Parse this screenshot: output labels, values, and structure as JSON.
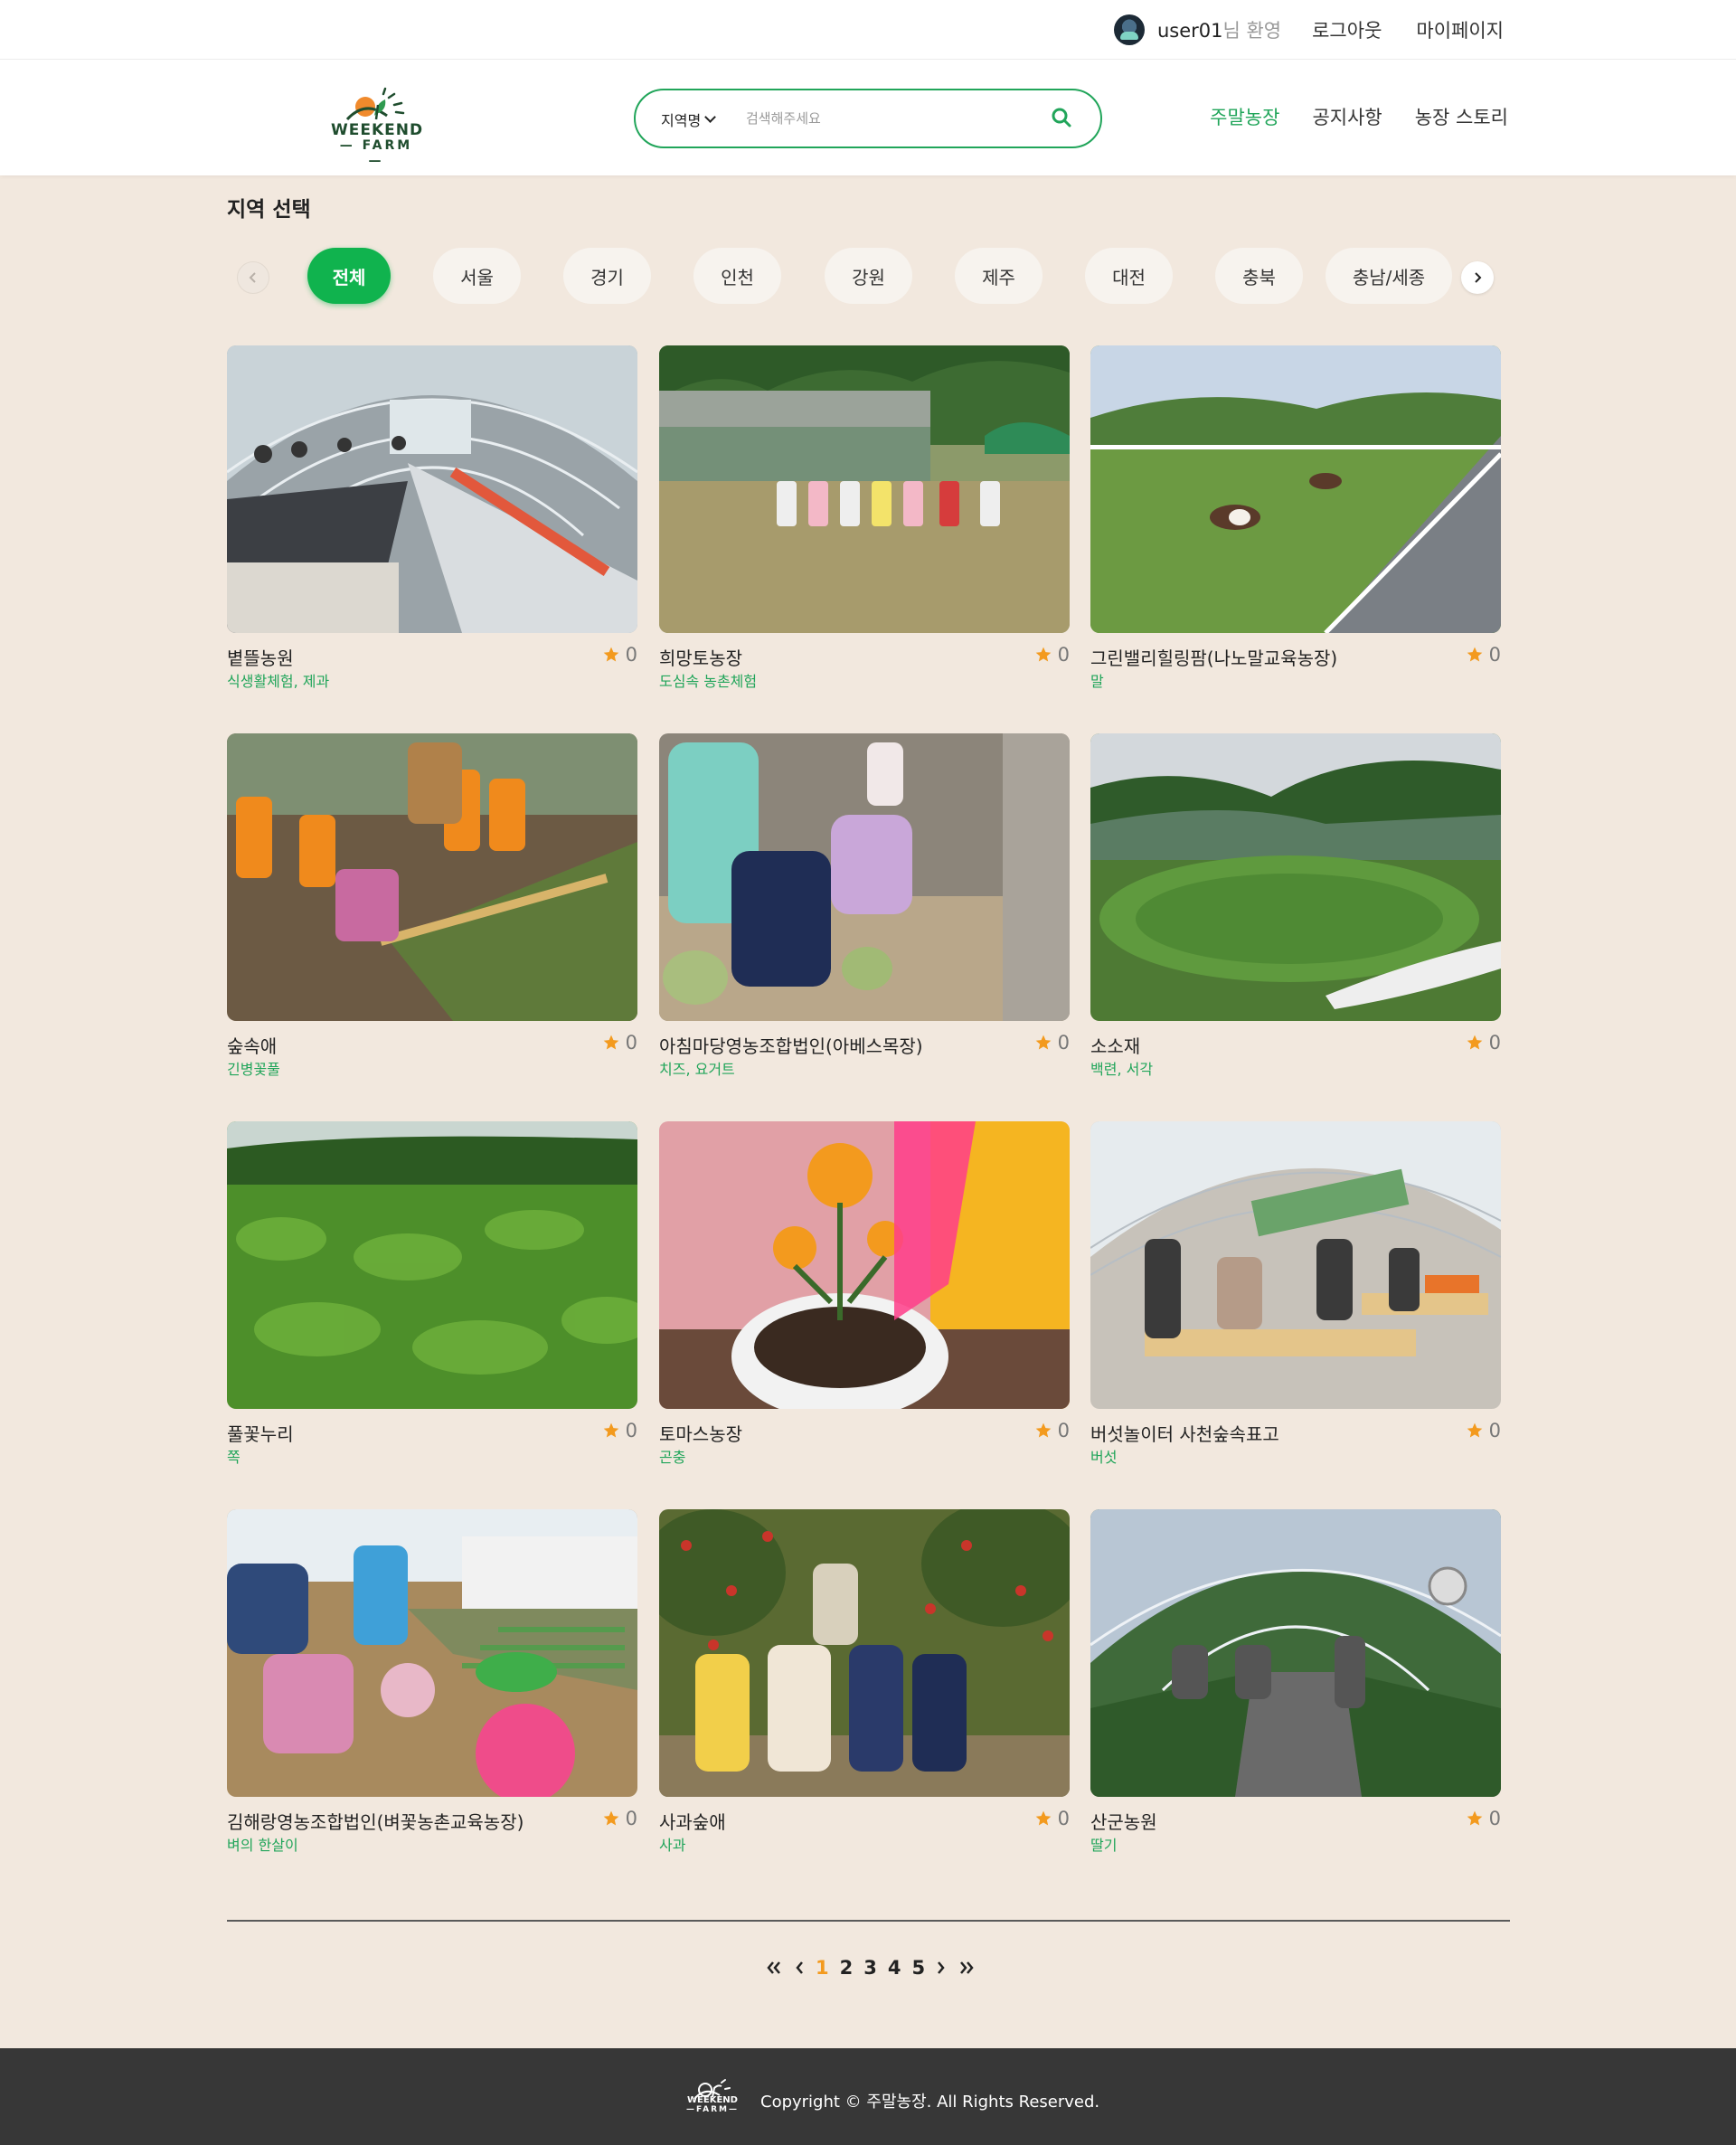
{
  "topbar": {
    "username": "user01",
    "welcome_suffix": "님 환영",
    "logout": "로그아웃",
    "mypage": "마이페이지"
  },
  "header": {
    "logo_line1": "WEEKEND",
    "logo_line2": "FARM",
    "region_select": "지역명",
    "search_placeholder": "검색해주세요",
    "nav": [
      "주말농장",
      "공지사항",
      "농장 스토리"
    ]
  },
  "region": {
    "title": "지역 선택",
    "chips": [
      "전체",
      "서울",
      "경기",
      "인천",
      "강원",
      "제주",
      "대전",
      "충북",
      "충남/세종"
    ],
    "active": "전체"
  },
  "farms": [
    {
      "name": "볕뜰농원",
      "tags": "식생활체험, 제과",
      "rating": "0",
      "scene": "greenhouse-dining"
    },
    {
      "name": "희망토농장",
      "tags": "도심속 농촌체험",
      "rating": "0",
      "scene": "kids-field"
    },
    {
      "name": "그린밸리힐링팜(나노말교육농장)",
      "tags": "말",
      "rating": "0",
      "scene": "horse-pasture"
    },
    {
      "name": "숲속애",
      "tags": "긴병꽃풀",
      "rating": "0",
      "scene": "kids-garden"
    },
    {
      "name": "아침마당영농조합법인(아베스목장)",
      "tags": "치즈, 요거트",
      "rating": "0",
      "scene": "kids-sheep"
    },
    {
      "name": "소소재",
      "tags": "백련, 서각",
      "rating": "0",
      "scene": "lotus-pond"
    },
    {
      "name": "풀꽃누리",
      "tags": "쪽",
      "rating": "0",
      "scene": "green-field"
    },
    {
      "name": "토마스농장",
      "tags": "곤충",
      "rating": "0",
      "scene": "marigold"
    },
    {
      "name": "버섯놀이터 사천숲속표고",
      "tags": "버섯",
      "rating": "0",
      "scene": "mushroom-house"
    },
    {
      "name": "김해랑영농조합법인(벼꽃농촌교육농장)",
      "tags": "벼의 한살이",
      "rating": "0",
      "scene": "rice-planting"
    },
    {
      "name": "사과숲애",
      "tags": "사과",
      "rating": "0",
      "scene": "apple-orchard"
    },
    {
      "name": "산군농원",
      "tags": "딸기",
      "rating": "0",
      "scene": "strawberry-house"
    }
  ],
  "pagination": {
    "pages": [
      "1",
      "2",
      "3",
      "4",
      "5"
    ],
    "current": "1"
  },
  "footer": {
    "logo_line1": "WEEKEND",
    "logo_line2": "FARM",
    "copyright": "Copyright © 주말농장. All Rights Reserved."
  },
  "colors": {
    "accent": "#21a55a",
    "chip_active": "#10b34e",
    "star": "#f39a1e",
    "page_bg": "#f2e8de",
    "footer_bg": "#373737"
  }
}
